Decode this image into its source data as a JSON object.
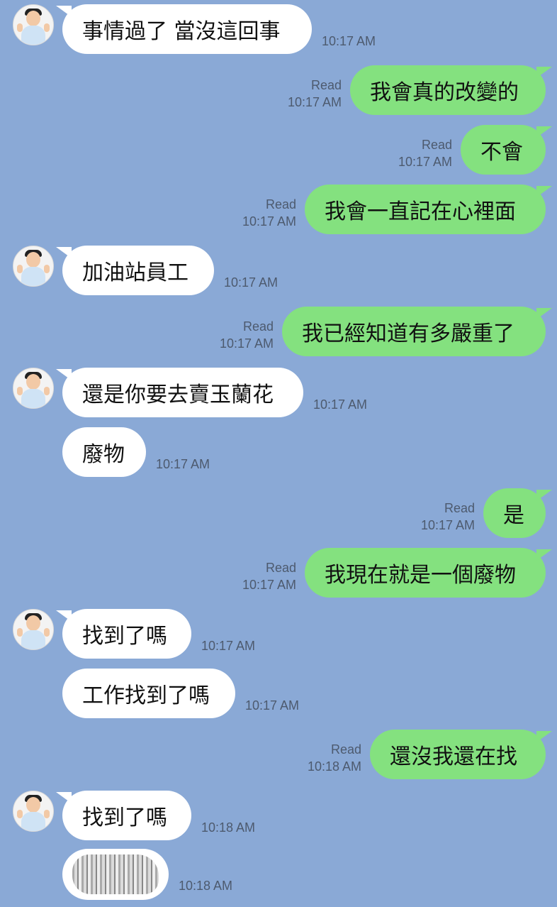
{
  "messages": [
    {
      "side": "in",
      "text": "事情過了 當沒這回事",
      "time": "10:17 AM"
    },
    {
      "side": "out",
      "text": "我會真的改變的",
      "read": "Read",
      "time": "10:17 AM"
    },
    {
      "side": "out",
      "text": "不會",
      "read": "Read",
      "time": "10:17 AM"
    },
    {
      "side": "out",
      "text": "我會一直記在心裡面",
      "read": "Read",
      "time": "10:17 AM"
    },
    {
      "side": "in",
      "text": "加油站員工",
      "time": "10:17 AM"
    },
    {
      "side": "out",
      "text": "我已經知道有多嚴重了",
      "read": "Read",
      "time": "10:17 AM"
    },
    {
      "side": "in",
      "text": "還是你要去賣玉蘭花",
      "time": "10:17 AM"
    },
    {
      "side": "in",
      "text": "廢物",
      "time": "10:17 AM"
    },
    {
      "side": "out",
      "text": "是",
      "read": "Read",
      "time": "10:17 AM"
    },
    {
      "side": "out",
      "text": "我現在就是一個廢物",
      "read": "Read",
      "time": "10:17 AM"
    },
    {
      "side": "in",
      "text": "找到了嗎",
      "time": "10:17 AM"
    },
    {
      "side": "in",
      "text": "工作找到了嗎",
      "time": "10:17 AM"
    },
    {
      "side": "out",
      "text": "還沒我還在找",
      "read": "Read",
      "time": "10:18 AM"
    },
    {
      "side": "in",
      "text": "找到了嗎",
      "time": "10:18 AM"
    },
    {
      "side": "in",
      "image": "blurred-photo",
      "time": "10:18 AM"
    }
  ],
  "icons": {
    "avatar": "contact-avatar-icon"
  },
  "colors": {
    "background": "#8aa9d6",
    "incoming_bubble": "#ffffff",
    "outgoing_bubble": "#84e17f",
    "meta_text": "#4d5a6e"
  }
}
